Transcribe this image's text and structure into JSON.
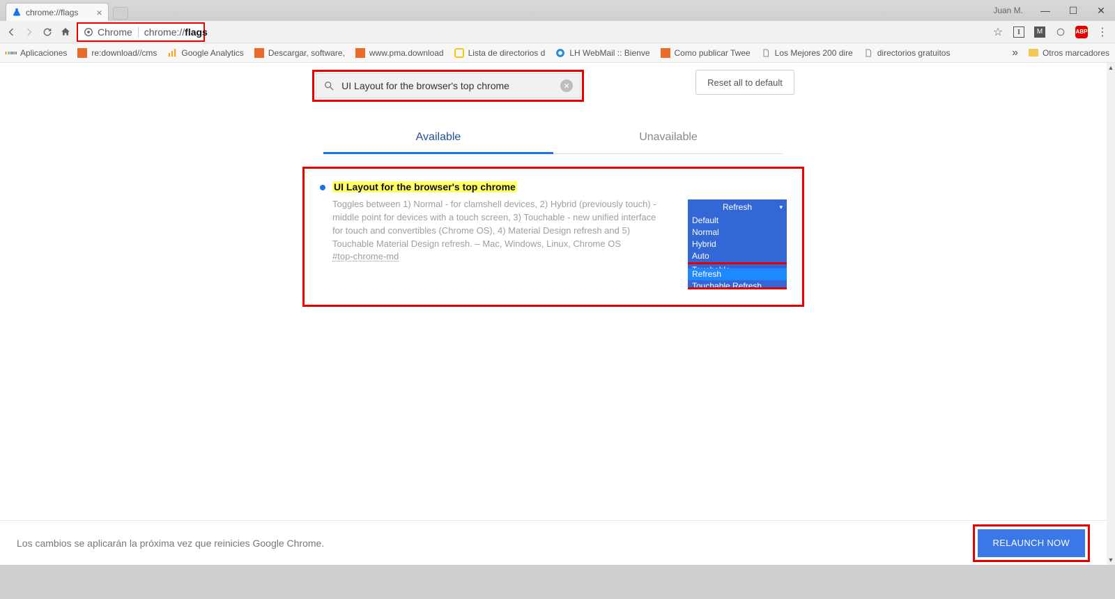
{
  "window": {
    "tab_title": "chrome://flags",
    "user": "Juan M."
  },
  "omnibox": {
    "prefix": "Chrome",
    "url_prefix": "chrome://",
    "url_bold": "flags"
  },
  "bookmarks": {
    "apps": "Aplicaciones",
    "items": [
      "re:download//cms",
      "Google Analytics",
      "Descargar, software,",
      "www.pma.download",
      "Lista de directorios d",
      "LH WebMail :: Bienve",
      "Como publicar Twee",
      "Los Mejores 200 dire",
      "directorios gratuitos"
    ],
    "other": "Otros marcadores"
  },
  "search": {
    "value": "UI Layout for the browser's top chrome"
  },
  "reset_label": "Reset all to default",
  "tabs": {
    "available": "Available",
    "unavailable": "Unavailable"
  },
  "flag": {
    "title": "UI Layout for the browser's top chrome",
    "desc": "Toggles between 1) Normal - for clamshell devices, 2) Hybrid (previously touch) - middle point for devices with a touch screen, 3) Touchable - new unified interface for touch and convertibles (Chrome OS), 4) Material Design refresh and 5) Touchable Material Design refresh. – Mac, Windows, Linux, Chrome OS",
    "link": "#top-chrome-md",
    "selected": "Refresh",
    "options": [
      "Default",
      "Normal",
      "Hybrid",
      "Auto",
      "Touchable",
      "Refresh",
      "Touchable Refresh"
    ]
  },
  "bottom": {
    "msg": "Los cambios se aplicarán la próxima vez que reinicies Google Chrome.",
    "relaunch": "RELAUNCH NOW"
  }
}
